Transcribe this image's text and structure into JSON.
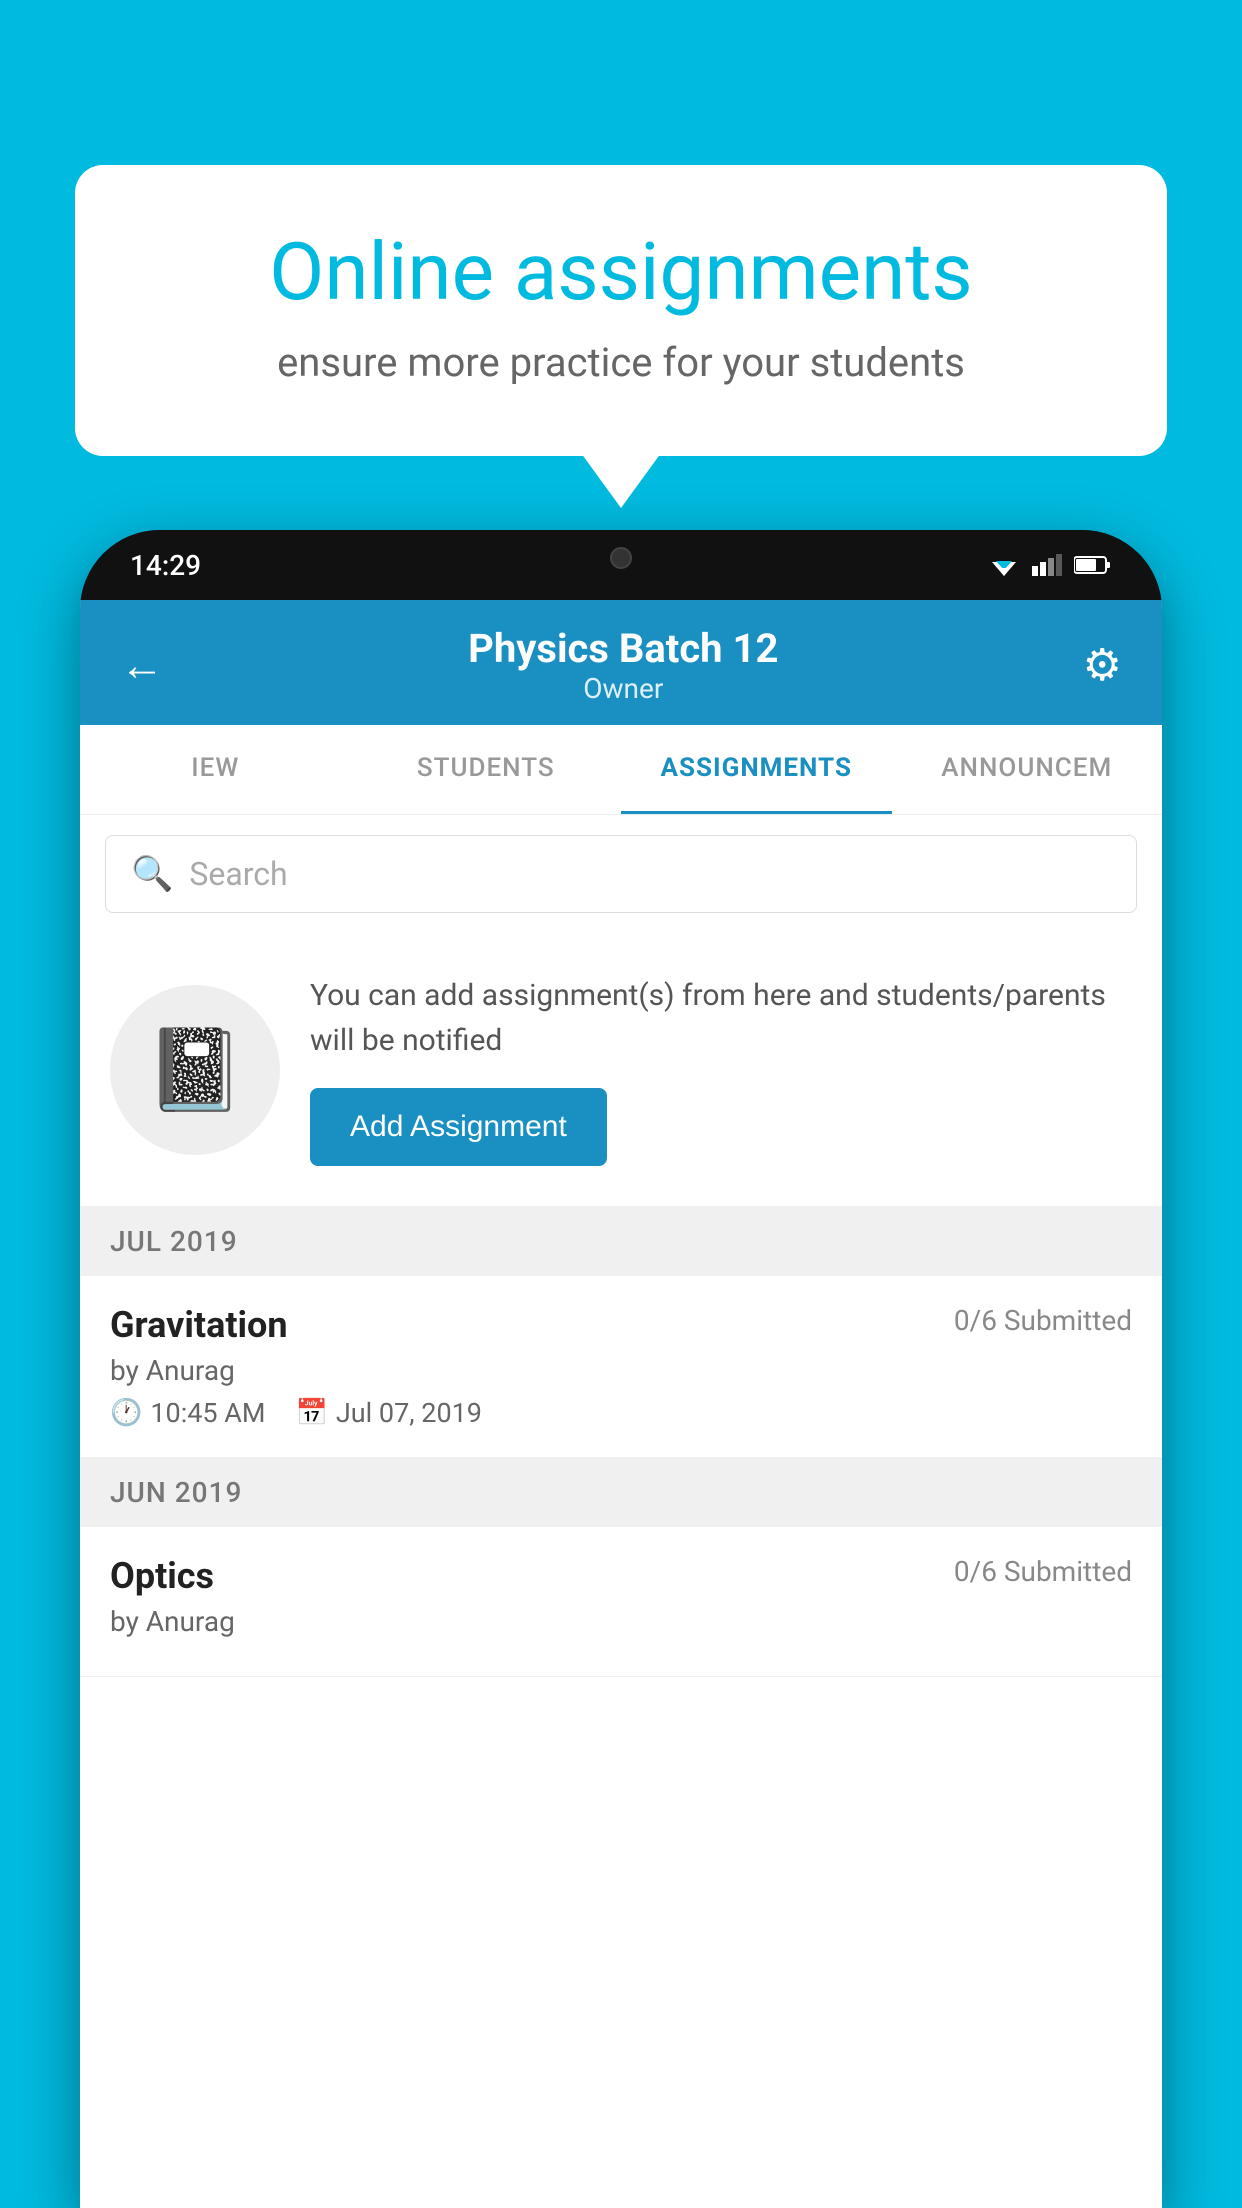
{
  "background": {
    "color": "#00BADF"
  },
  "speech_bubble": {
    "title": "Online assignments",
    "subtitle": "ensure more practice for your students"
  },
  "phone": {
    "time": "14:29",
    "header": {
      "title": "Physics Batch 12",
      "subtitle": "Owner",
      "back_label": "←",
      "settings_label": "⚙"
    },
    "tabs": [
      {
        "label": "IEW",
        "active": false
      },
      {
        "label": "STUDENTS",
        "active": false
      },
      {
        "label": "ASSIGNMENTS",
        "active": true
      },
      {
        "label": "ANNOUNCЕМ",
        "active": false
      }
    ],
    "search": {
      "placeholder": "Search"
    },
    "info_section": {
      "description": "You can add assignment(s) from here and students/parents will be notified",
      "button_label": "Add Assignment"
    },
    "sections": [
      {
        "label": "JUL 2019",
        "assignments": [
          {
            "name": "Gravitation",
            "submitted": "0/6 Submitted",
            "by": "by Anurag",
            "time": "10:45 AM",
            "date": "Jul 07, 2019"
          }
        ]
      },
      {
        "label": "JUN 2019",
        "assignments": [
          {
            "name": "Optics",
            "submitted": "0/6 Submitted",
            "by": "by Anurag",
            "time": "",
            "date": ""
          }
        ]
      }
    ]
  }
}
